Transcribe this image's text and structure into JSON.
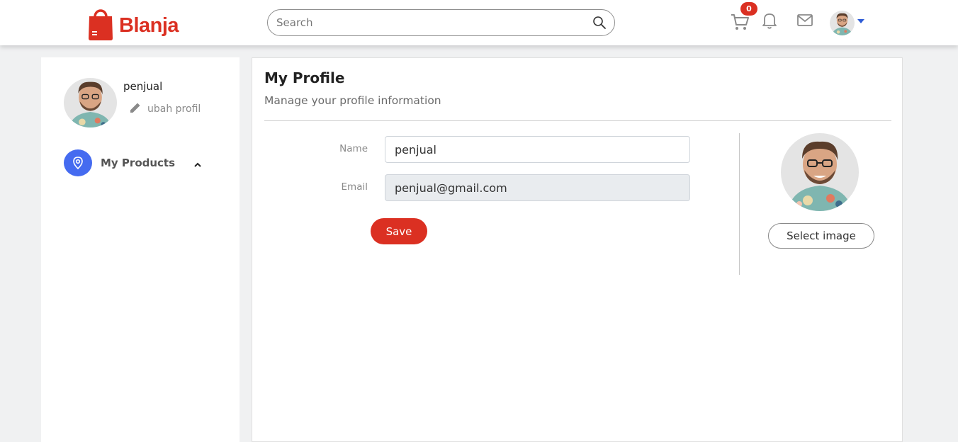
{
  "brand": {
    "name": "Blanja",
    "color": "#db3022"
  },
  "header": {
    "search_placeholder": "Search",
    "cart_count": "0",
    "icons": [
      "cart-icon",
      "bell-icon",
      "mail-icon",
      "user-avatar",
      "caret-down-icon"
    ]
  },
  "sidebar": {
    "user_name": "penjual",
    "edit_label": "ubah profil",
    "menu": [
      {
        "label": "My Products",
        "icon": "location-pin-icon",
        "expanded": true
      }
    ]
  },
  "profile": {
    "title": "My Profile",
    "subtitle": "Manage your profile information",
    "name_label": "Name",
    "name_value": "penjual",
    "email_label": "Email",
    "email_value": "penjual@gmail.com",
    "save_label": "Save",
    "select_image_label": "Select image"
  },
  "colors": {
    "accent": "#db3022",
    "menu_icon_bg": "#456bf0",
    "caret": "#2e5cd6"
  }
}
